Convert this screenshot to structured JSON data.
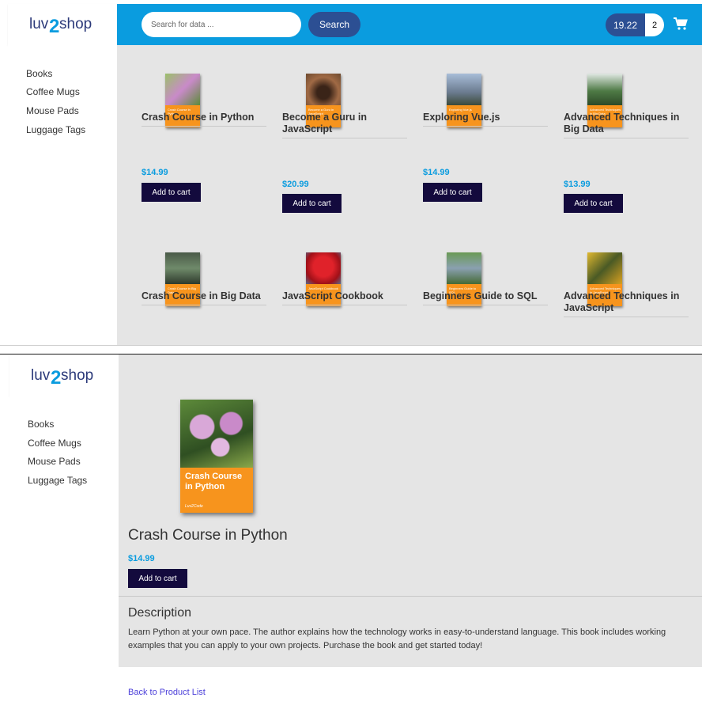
{
  "brand": {
    "logo_text_left": "luv",
    "logo_text_mid": "2",
    "logo_text_right": "shop"
  },
  "search": {
    "placeholder": "Search for data ...",
    "button_label": "Search"
  },
  "cart": {
    "total": "19.22",
    "quantity": "2",
    "icon": "shopping-cart-icon"
  },
  "sidebar": {
    "items": [
      {
        "label": "Books"
      },
      {
        "label": "Coffee Mugs"
      },
      {
        "label": "Mouse Pads"
      },
      {
        "label": "Luggage Tags"
      }
    ]
  },
  "product_list": {
    "add_to_cart_label": "Add to cart",
    "products": [
      {
        "name": "Crash Course in Python",
        "price": "$14.99",
        "cover_text": "Crash Course in Python",
        "cover_art": "#7aa04a"
      },
      {
        "name": "Become a Guru in JavaScript",
        "price": "$20.99",
        "cover_text": "Become a Guru in JavaScript",
        "cover_art": "#8a5a3a"
      },
      {
        "name": "Exploring Vue.js",
        "price": "$14.99",
        "cover_text": "Exploring Vue.js",
        "cover_art": "#8fa4c0"
      },
      {
        "name": "Advanced Techniques in Big Data",
        "price": "$13.99",
        "cover_text": "Advanced Techniques in Big Data",
        "cover_art": "#3e6d3a"
      },
      {
        "name": "Crash Course in Big Data",
        "price": "",
        "cover_text": "Crash Course in Big Data",
        "cover_art": "#3b4b3a"
      },
      {
        "name": "JavaScript Cookbook",
        "price": "",
        "cover_text": "JavaScript Cookbook",
        "cover_art": "#c8191f"
      },
      {
        "name": "Beginners Guide to SQL",
        "price": "",
        "cover_text": "Beginners Guide to SQL",
        "cover_art": "#4f7a3a"
      },
      {
        "name": "Advanced Techniques in JavaScript",
        "price": "",
        "cover_text": "Advanced Techniques in JavaScript",
        "cover_art": "#c8a52a"
      }
    ]
  },
  "product_detail": {
    "name": "Crash Course in Python",
    "price": "$14.99",
    "add_to_cart_label": "Add to cart",
    "cover_text": "Crash Course in Python",
    "cover_author": "Luv2Code",
    "description_heading": "Description",
    "description": "Learn Python at your own pace. The author explains how the technology works in easy-to-understand language. This book includes working examples that you can apply to your own projects. Purchase the book and get started today!",
    "back_link": "Back to Product List"
  },
  "colors": {
    "header": "#0a9cdf",
    "button_dark": "#130a3d",
    "search_button": "#2c4f93",
    "price": "#0a9cdf",
    "link": "#4b3fd9",
    "cover_band": "#f7941d"
  }
}
